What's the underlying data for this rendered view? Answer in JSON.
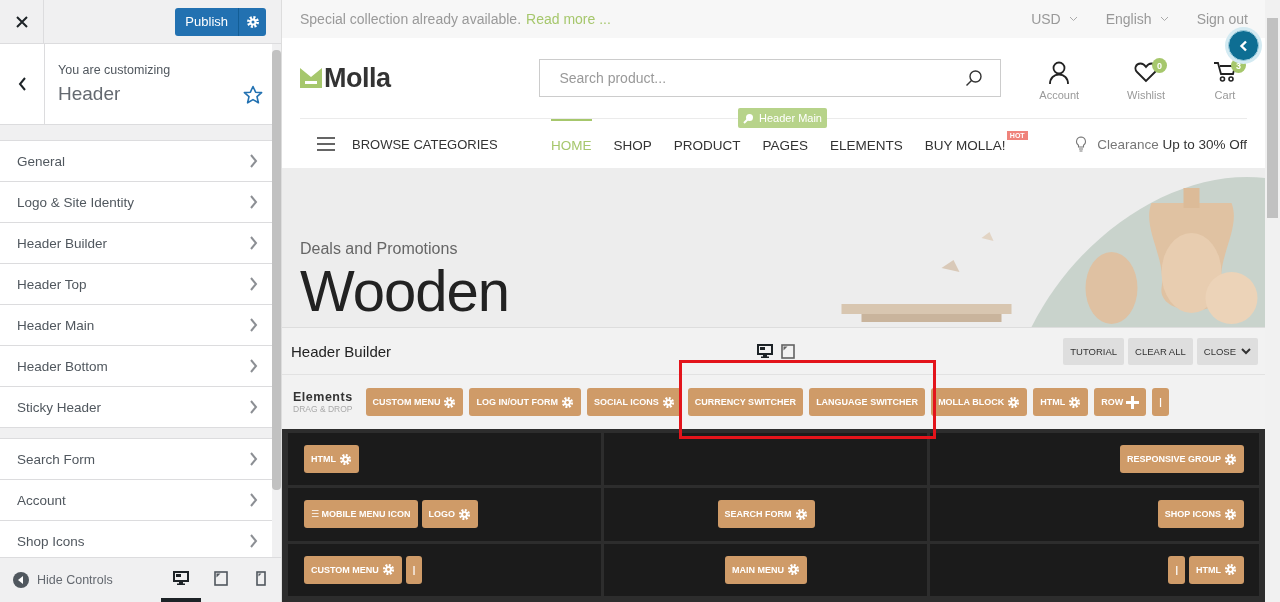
{
  "customizer": {
    "publish_label": "Publish",
    "context_label": "You are customizing",
    "context_title": "Header",
    "sections": [
      {
        "items": [
          {
            "label": "General"
          },
          {
            "label": "Logo & Site Identity"
          },
          {
            "label": "Header Builder"
          },
          {
            "label": "Header Top"
          },
          {
            "label": "Header Main"
          },
          {
            "label": "Header Bottom"
          },
          {
            "label": "Sticky Header"
          }
        ]
      },
      {
        "items": [
          {
            "label": "Search Form"
          },
          {
            "label": "Account"
          },
          {
            "label": "Shop Icons"
          }
        ]
      }
    ],
    "hide_controls": "Hide Controls",
    "devices": [
      {
        "kind": "desktop",
        "selected": true
      },
      {
        "kind": "tablet",
        "selected": false
      },
      {
        "kind": "mobile",
        "selected": false
      }
    ]
  },
  "topbar": {
    "message": "Special collection already available.",
    "link": "Read more ...",
    "currency": "USD",
    "language": "English",
    "signout": "Sign out"
  },
  "header": {
    "logo": "Molla",
    "search": {
      "placeholder": "Search product..."
    },
    "icons": [
      {
        "kind": "account",
        "label": "Account"
      },
      {
        "kind": "wishlist",
        "label": "Wishlist",
        "badge": "0"
      },
      {
        "kind": "cart",
        "label": "Cart",
        "badge": "3"
      }
    ]
  },
  "nav": {
    "browse": "BROWSE CATEGORIES",
    "tooltip": "Header Main",
    "items": [
      {
        "label": "HOME",
        "selected": true
      },
      {
        "label": "SHOP",
        "selected": false
      },
      {
        "label": "PRODUCT",
        "selected": false
      },
      {
        "label": "PAGES",
        "selected": false
      },
      {
        "label": "ELEMENTS",
        "selected": false
      },
      {
        "label": "BUY MOLLA!",
        "selected": false,
        "badge": "HOT"
      }
    ],
    "promo": "Clearance **Up to 30% Off**"
  },
  "hero": {
    "kind": "picture",
    "subtitle": "Deals and Promotions",
    "title": "Wooden"
  },
  "builder": {
    "title": "Header Builder",
    "devices": [
      {
        "kind": "desktop",
        "selected": true
      },
      {
        "kind": "tablet",
        "selected": false
      }
    ],
    "buttons": [
      {
        "label": "TUTORIAL",
        "kind": "plain"
      },
      {
        "label": "CLEAR ALL",
        "kind": "plain"
      },
      {
        "label": "CLOSE",
        "kind": "caret"
      }
    ],
    "elements_title": "Elements",
    "elements_hint": "DRAG & DROP",
    "elements": [
      {
        "label": "CUSTOM MENU",
        "kind": "gear"
      },
      {
        "label": "LOG IN/OUT FORM",
        "kind": "gear"
      },
      {
        "label": "SOCIAL ICONS",
        "kind": "gear"
      },
      {
        "label": "CURRENCY SWITCHER",
        "kind": "plain"
      },
      {
        "label": "LANGUAGE SWITCHER",
        "kind": "plain"
      },
      {
        "label": "MOLLA BLOCK",
        "kind": "gear"
      },
      {
        "label": "HTML",
        "kind": "gear"
      },
      {
        "label": "ROW",
        "kind": "plus"
      },
      {
        "label": "|",
        "kind": "plain"
      }
    ],
    "rows": [
      [
        [
          {
            "label": "HTML",
            "kind": "gear"
          }
        ],
        [],
        [
          {
            "label": "RESPONSIVE GROUP",
            "kind": "gear"
          }
        ]
      ],
      [
        [
          {
            "label": "☰ MOBILE MENU ICON",
            "kind": "plain"
          },
          {
            "label": "LOGO",
            "kind": "gear"
          }
        ],
        [
          {
            "label": "SEARCH FORM",
            "kind": "gear"
          }
        ],
        [
          {
            "label": "SHOP ICONS",
            "kind": "gear"
          }
        ]
      ],
      [
        [
          {
            "label": "CUSTOM MENU",
            "kind": "gear"
          },
          {
            "label": "|",
            "kind": "plain"
          }
        ],
        [
          {
            "label": "MAIN MENU",
            "kind": "gear"
          }
        ],
        [
          {
            "label": "|",
            "kind": "plain"
          },
          {
            "label": "HTML",
            "kind": "gear"
          }
        ]
      ]
    ]
  }
}
